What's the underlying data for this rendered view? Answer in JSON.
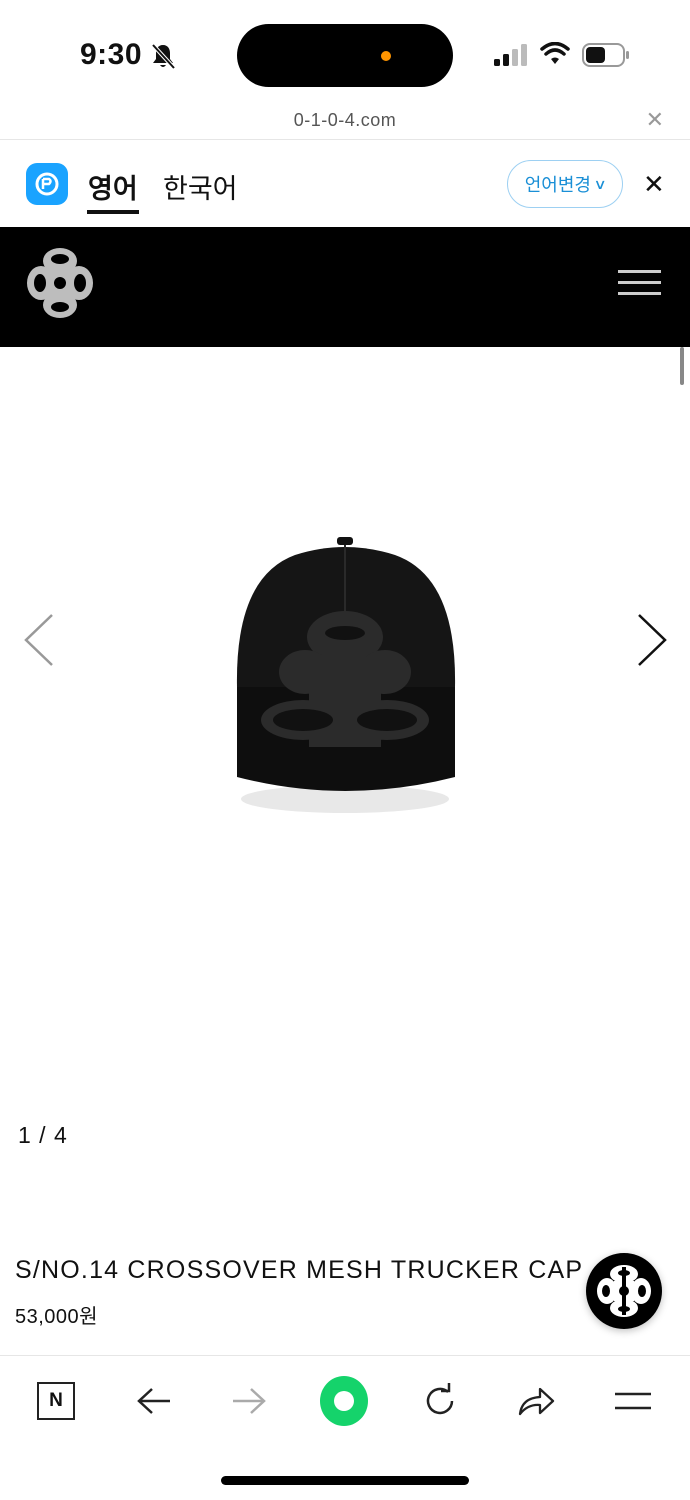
{
  "status_bar": {
    "time": "9:30"
  },
  "browser": {
    "url": "0-1-0-4.com"
  },
  "translate_bar": {
    "source_lang": "영어",
    "target_lang": "한국어",
    "change_button_label": "언어변경"
  },
  "gallery": {
    "counter": "1 / 4"
  },
  "product": {
    "title": "S/NO.14 CROSSOVER MESH TRUCKER CAP",
    "price": "53,000원"
  },
  "toolbar": {
    "naver_label": "N"
  },
  "colors": {
    "header_bg": "#000000",
    "translate_accent": "#1a8fd6",
    "papago_blue": "#1aa3ff",
    "home_green": "#15d36b",
    "island_dot": "#ff9500"
  },
  "icons": [
    "bell-off-icon",
    "signal-icon",
    "wifi-icon",
    "battery-icon",
    "close-icon",
    "papago-icon",
    "chevron-down-icon",
    "brand-logo",
    "hamburger-icon",
    "chevron-left-icon",
    "chevron-right-icon",
    "naver-icon",
    "back-arrow-icon",
    "forward-arrow-icon",
    "home-icon",
    "reload-icon",
    "share-icon",
    "menu-icon"
  ]
}
